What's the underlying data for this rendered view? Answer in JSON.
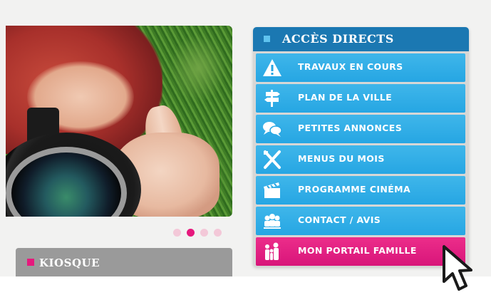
{
  "slider": {
    "dots": [
      false,
      true,
      false,
      false
    ]
  },
  "kiosque": {
    "title": "KIOSQUE"
  },
  "acces_directs": {
    "title": "ACCÈS DIRECTS",
    "items": [
      {
        "label": "TRAVAUX EN COURS",
        "icon": "warning-icon"
      },
      {
        "label": "PLAN DE LA VILLE",
        "icon": "signpost-icon"
      },
      {
        "label": "PETITES ANNONCES",
        "icon": "speech-bubbles-icon"
      },
      {
        "label": "MENUS DU MOIS",
        "icon": "fork-knife-icon"
      },
      {
        "label": "PROGRAMME CINÉMA",
        "icon": "clapperboard-icon"
      },
      {
        "label": "CONTACT / AVIS",
        "icon": "people-icon"
      },
      {
        "label": "MON PORTAIL FAMILLE",
        "icon": "family-icon"
      }
    ]
  },
  "colors": {
    "panel_header": "#1b78b2",
    "menu_item": "#26a6e3",
    "highlight": "#e6197d",
    "kiosque_header": "#9a9a9a"
  }
}
